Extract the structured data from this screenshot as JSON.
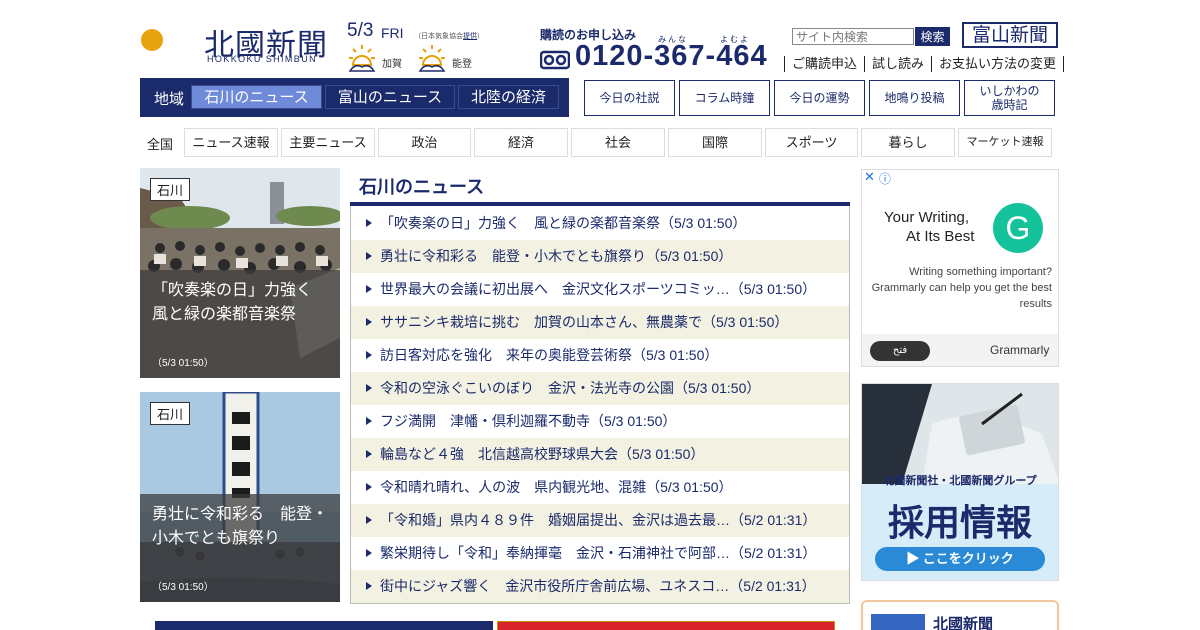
{
  "header": {
    "logo_kanji": "北國新聞",
    "logo_romaji": "HOKKOKU SHIMBUN",
    "date": "5/3",
    "weekday": "FRI",
    "weather_credit_prefix": "（日本気象協会",
    "weather_credit_link": "提供",
    "weather_credit_suffix": "）",
    "weather": [
      {
        "place": "加賀",
        "icon": "sunny-icon"
      },
      {
        "place": "能登",
        "icon": "sunny-icon"
      }
    ],
    "subscribe_title": "購読のお申し込み",
    "ruby_minna": "みんな",
    "ruby_yomu": "よむよ",
    "phone": "0120-367-464",
    "search_placeholder": "サイト内検索",
    "search_button": "検索",
    "toyama_button": "富山新聞",
    "toplinks": [
      "ご購読申込",
      "試し読み",
      "お支払い方法の変更"
    ]
  },
  "region_nav": {
    "label": "地域",
    "tabs": [
      "石川のニュース",
      "富山のニュース",
      "北陸の経済"
    ],
    "active_index": 0
  },
  "feature_buttons": [
    "今日の社説",
    "コラム時鐘",
    "今日の運勢",
    "地鳴り投稿",
    "いしかわの\n歳時記"
  ],
  "categories": {
    "label": "全国",
    "items": [
      "ニュース速報",
      "主要ニュース",
      "政治",
      "経済",
      "社会",
      "国際",
      "スポーツ",
      "暮らし",
      "マーケット速報"
    ]
  },
  "photo_cards": [
    {
      "tag": "石川",
      "caption": "「吹奏楽の日」力強く　風と緑の楽都音楽祭",
      "time": "（5/3 01:50）"
    },
    {
      "tag": "石川",
      "caption": "勇壮に令和彩る　能登・小木でとも旗祭り",
      "time": "（5/3 01:50）"
    }
  ],
  "news": {
    "title": "石川のニュース",
    "items": [
      "「吹奏楽の日」力強く　風と緑の楽都音楽祭（5/3 01:50）",
      "勇壮に令和彩る　能登・小木でとも旗祭り（5/3 01:50）",
      "世界最大の会議に初出展へ　金沢文化スポーツコミッ…（5/3 01:50）",
      "ササニシキ栽培に挑む　加賀の山本さん、無農薬で（5/3 01:50）",
      "訪日客対応を強化　来年の奥能登芸術祭（5/3 01:50）",
      "令和の空泳ぐこいのぼり　金沢・法光寺の公園（5/3 01:50）",
      "フジ満開　津幡・倶利迦羅不動寺（5/3 01:50）",
      "輪島など４強　北信越高校野球県大会（5/3 01:50）",
      "令和晴れ晴れ、人の波　県内観光地、混雑（5/3 01:50）",
      "「令和婚」県内４８９件　婚姻届提出、金沢は過去最…（5/2 01:31）",
      "繁栄期待し「令和」奉納揮毫　金沢・石浦神社で阿部…（5/2 01:31）",
      "街中にジャズ響く　金沢市役所庁舎前広場、ユネスコ…（5/2 01:31）"
    ]
  },
  "ad_grammarly": {
    "headline1": "Your Writing,",
    "headline2": "At Its Best",
    "body": "Writing something important? Grammarly can help you get the best results",
    "cta": "فتح",
    "brand": "Grammarly",
    "logo_letter": "G",
    "close": "✕",
    "info": "ⓘ"
  },
  "ad_recruit": {
    "line1": "北國新聞社・北國新聞グループ",
    "line2": "採用情報",
    "cta": "▶ ここをクリック"
  },
  "ad_bottom": {
    "title": "北國新聞"
  },
  "colors": {
    "brand_navy": "#1b2a6b",
    "active_tab": "#6f8ad8",
    "alt_row": "#f3f1e1",
    "grammarly_green": "#15c39a"
  }
}
